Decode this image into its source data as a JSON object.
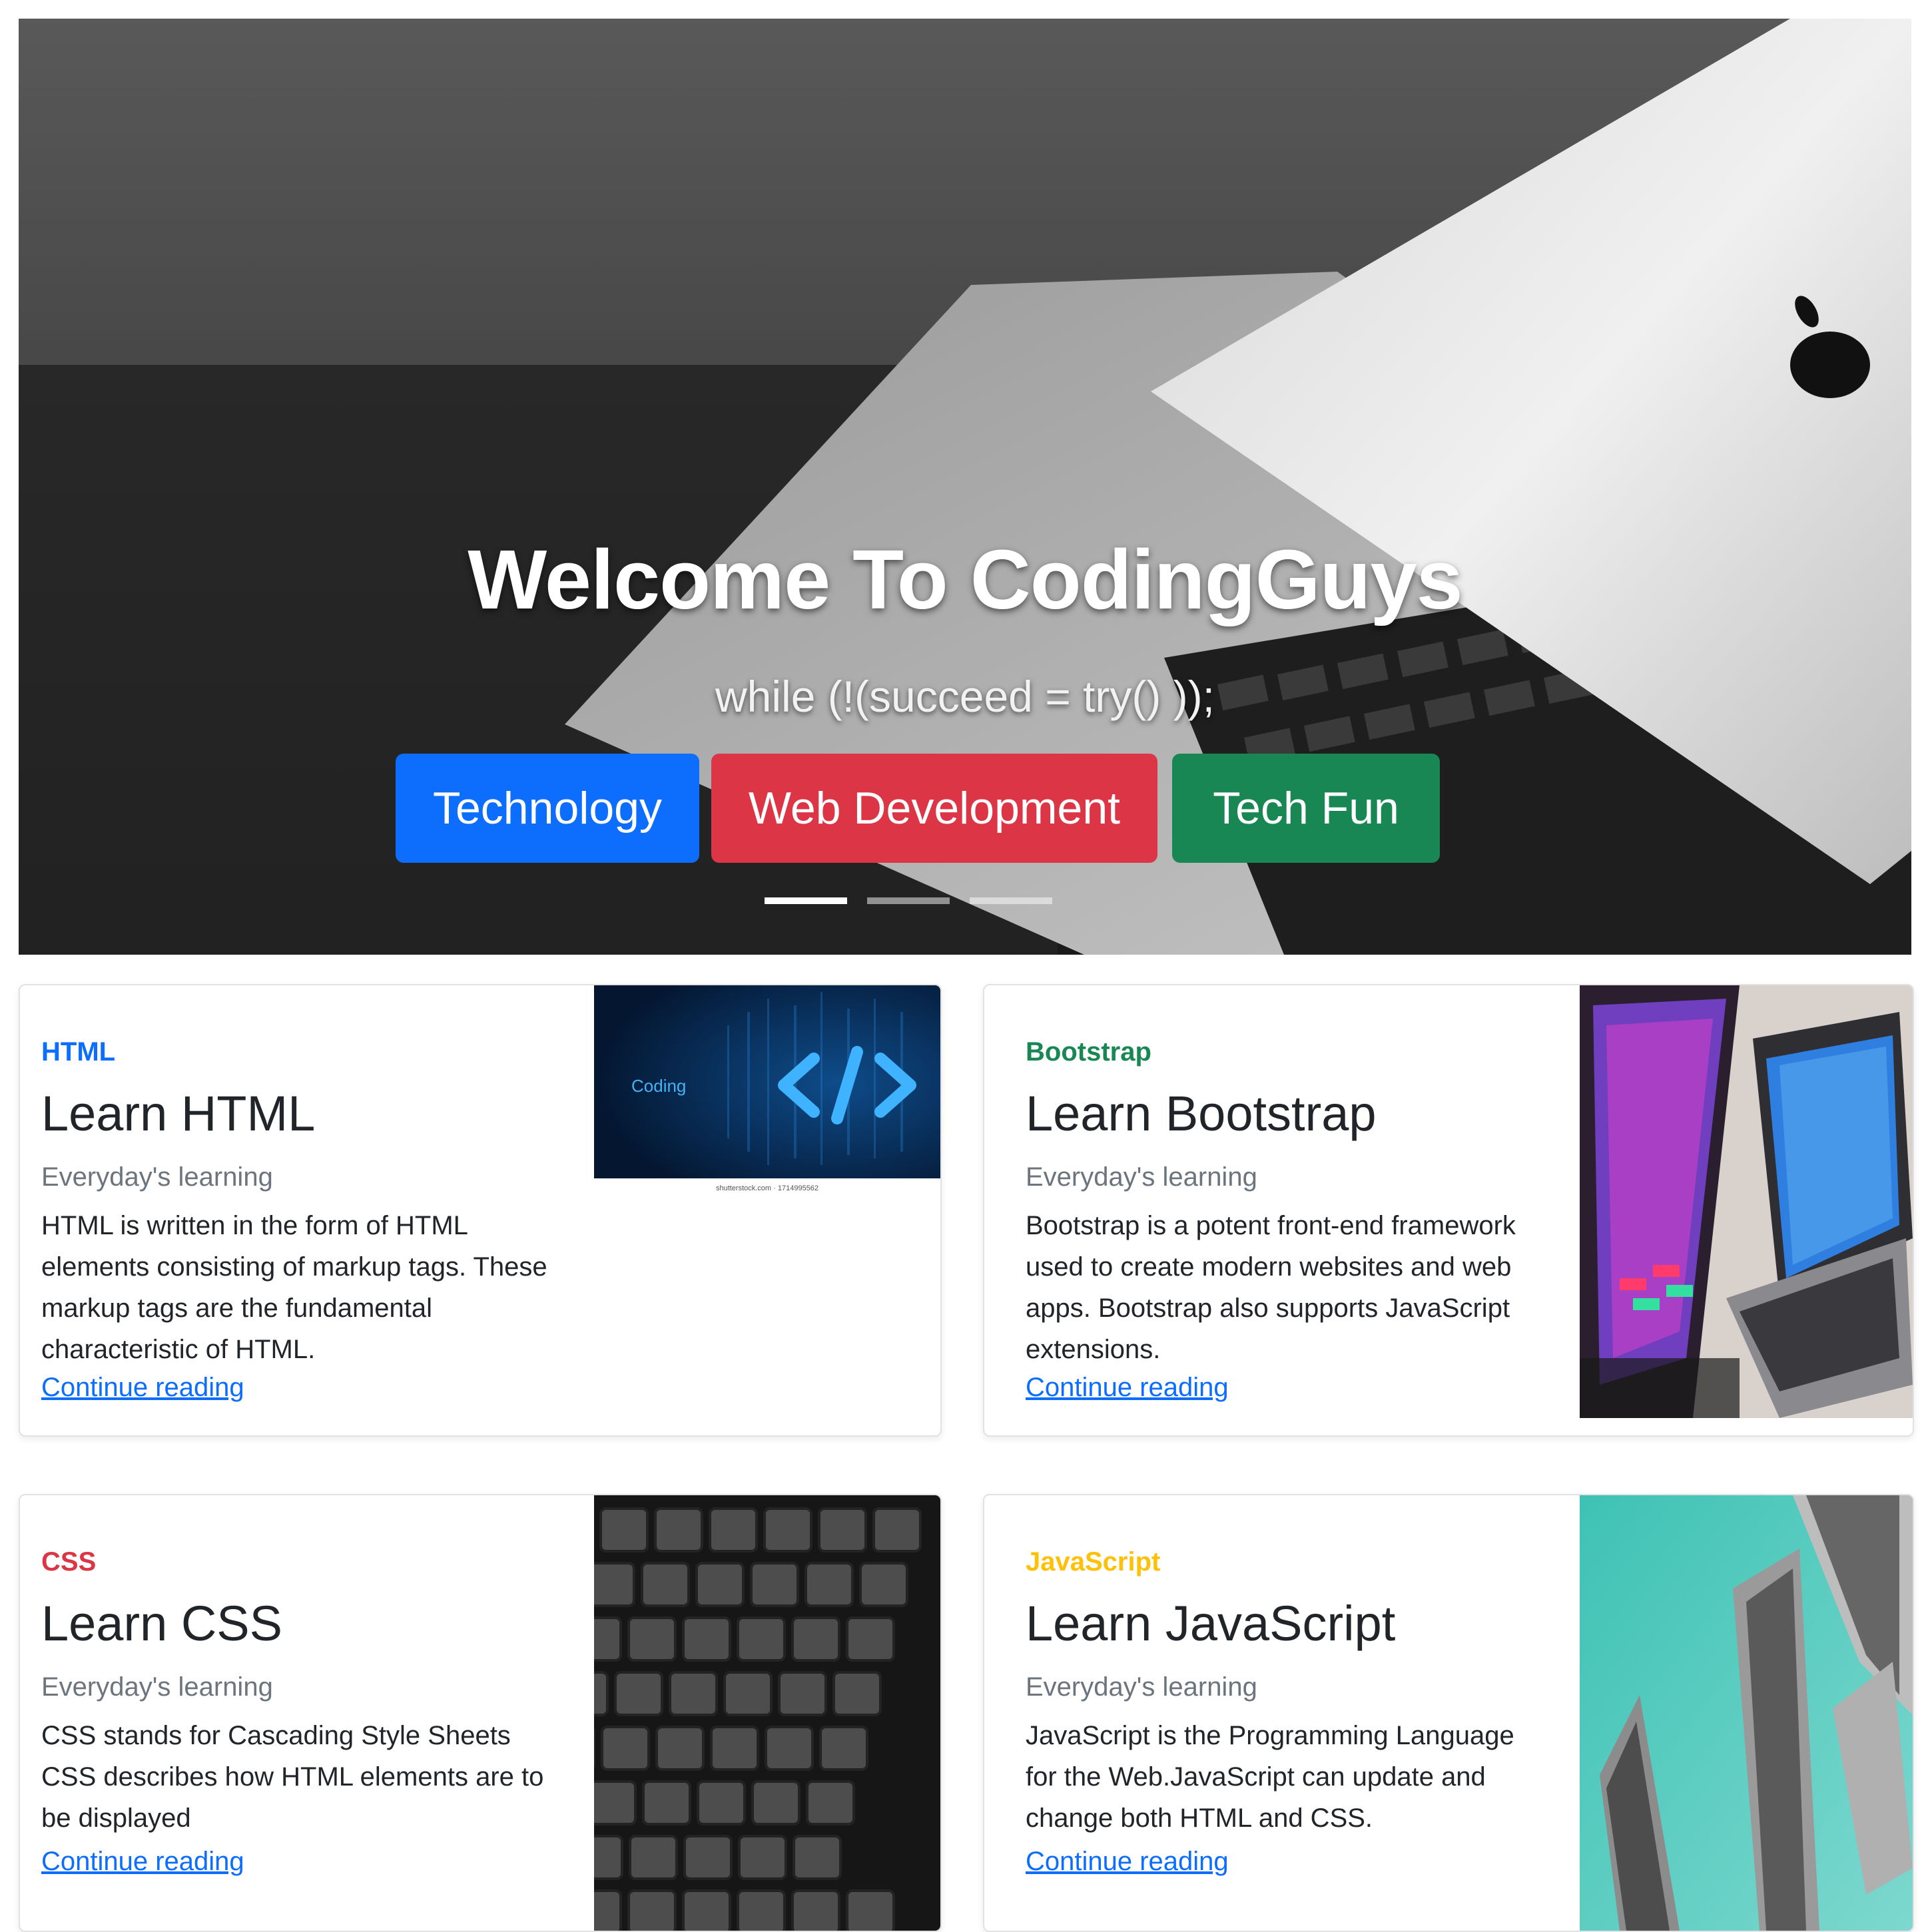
{
  "hero": {
    "title": "Welcome To CodingGuys",
    "subtitle": "while (!(succeed = try() ));",
    "buttons": [
      {
        "label": "Technology",
        "color": "#0d6efd"
      },
      {
        "label": "Web Development",
        "color": "#dc3545"
      },
      {
        "label": "Tech Fun",
        "color": "#198754"
      }
    ],
    "slides_total": 3,
    "active_slide": 1
  },
  "cards": [
    {
      "category": "HTML",
      "category_color": "#0d6efd",
      "title": "Learn HTML",
      "subtitle": "Everyday's learning",
      "text": "HTML is written in the form of HTML elements consisting of markup tags. These markup tags are the fundamental characteristic of HTML.",
      "link": "Continue reading",
      "image": {
        "caption": "Coding",
        "watermark": "shutterstock.com · 1714995562"
      }
    },
    {
      "category": "Bootstrap",
      "category_color": "#198754",
      "title": "Learn Bootstrap",
      "subtitle": "Everyday's learning",
      "text": "Bootstrap is a potent front-end framework used to create modern websites and web apps. Bootstrap also supports JavaScript extensions.",
      "link": "Continue reading"
    },
    {
      "category": "CSS",
      "category_color": "#dc3545",
      "title": "Learn CSS",
      "subtitle": "Everyday's learning",
      "text": "CSS stands for Cascading Style Sheets CSS describes how HTML elements are to be displayed",
      "link": "Continue reading"
    },
    {
      "category": "JavaScript",
      "category_color": "#ffc107",
      "title": "Learn JavaScript",
      "subtitle": "Everyday's learning",
      "text": "JavaScript is the Programming Language for the Web.JavaScript can update and change both HTML and CSS.",
      "link": "Continue reading"
    }
  ]
}
